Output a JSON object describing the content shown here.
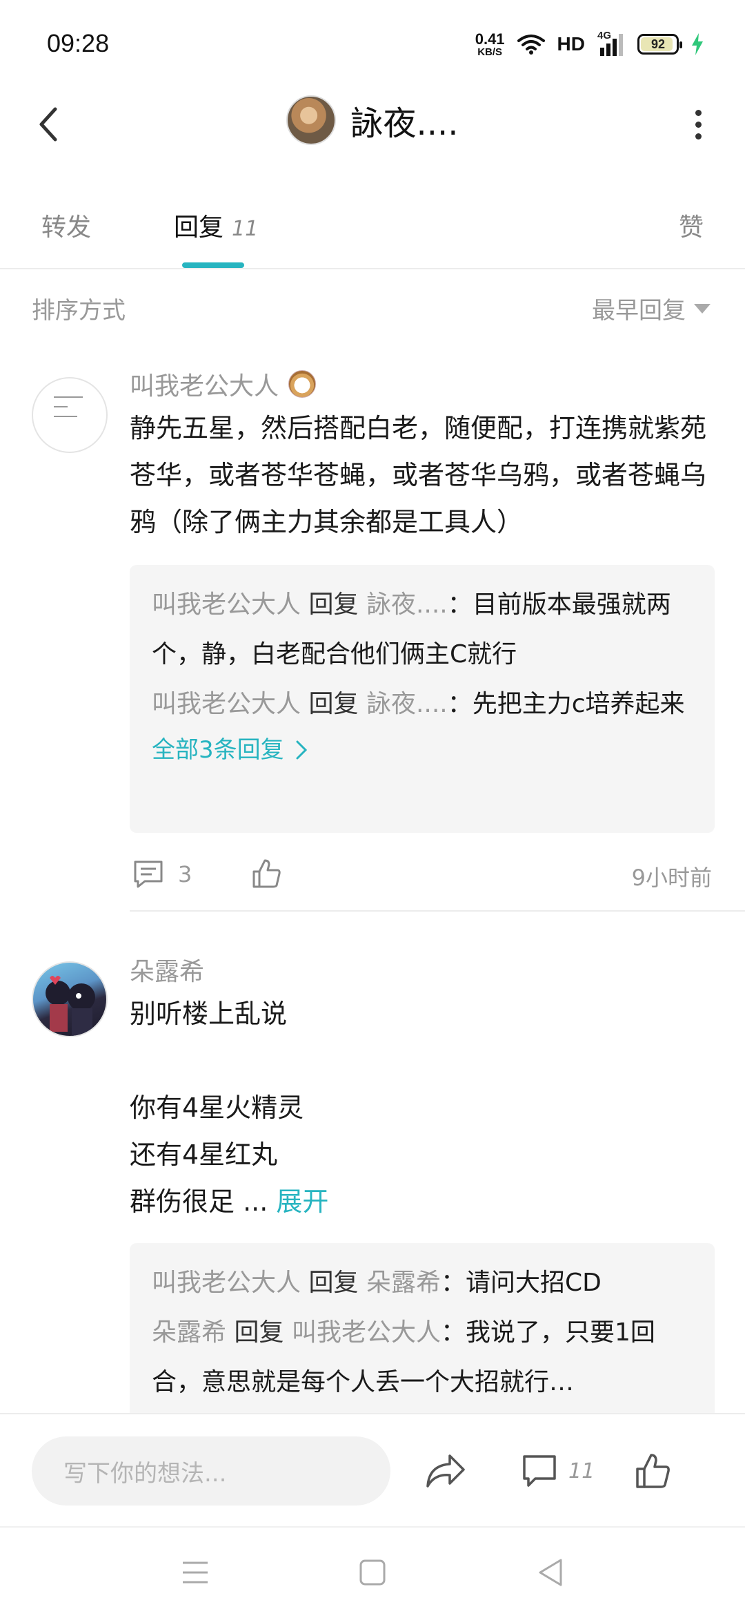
{
  "status_bar": {
    "time": "09:28",
    "net_speed_value": "0.41",
    "net_speed_unit": "KB/S",
    "hd": "HD",
    "network": "4G",
    "battery": "92"
  },
  "header": {
    "title": "詠夜....",
    "back_icon": "chevron-left-icon",
    "more_icon": "more-vertical-icon"
  },
  "tabs": {
    "forward": "转发",
    "reply": "回复",
    "reply_count": "11",
    "like": "赞"
  },
  "sort": {
    "label": "排序方式",
    "value": "最早回复"
  },
  "comments": [
    {
      "author": "叫我老公大人",
      "text": "静先五星，然后搭配白老，随便配，打连携就紫苑苍华，或者苍华苍蝇，或者苍华乌鸦，或者苍蝇乌鸦（除了俩主力其余都是工具人）",
      "replies": [
        {
          "from": "叫我老公大人",
          "verb": "回复",
          "to": "詠夜....",
          "text": "：目前版本最强就两个，静，白老配合他们俩主C就行"
        },
        {
          "from": "叫我老公大人",
          "verb": "回复",
          "to": "詠夜....",
          "text": "：先把主力c培养起来"
        }
      ],
      "all_replies": "全部3条回复",
      "reply_count": "3",
      "time": "9小时前"
    },
    {
      "author": "朵露希",
      "text_lines": [
        "别听楼上乱说",
        "",
        "你有4星火精灵",
        "还有4星红丸",
        "群伤很足 ..."
      ],
      "expand": "展开",
      "replies": [
        {
          "from": "叫我老公大人",
          "verb": "回复",
          "to": "朵露希",
          "text": "：请问大招CD"
        },
        {
          "from": "朵露希",
          "verb": "回复",
          "to": "叫我老公大人",
          "text": "：我说了，只要1回合，意思就是每个人丢一个大招就行…"
        }
      ]
    }
  ],
  "input_bar": {
    "placeholder": "写下你的想法...",
    "comment_count": "11"
  },
  "colors": {
    "accent": "#27b4c0",
    "muted": "#999999",
    "text": "#1a1a1a"
  }
}
